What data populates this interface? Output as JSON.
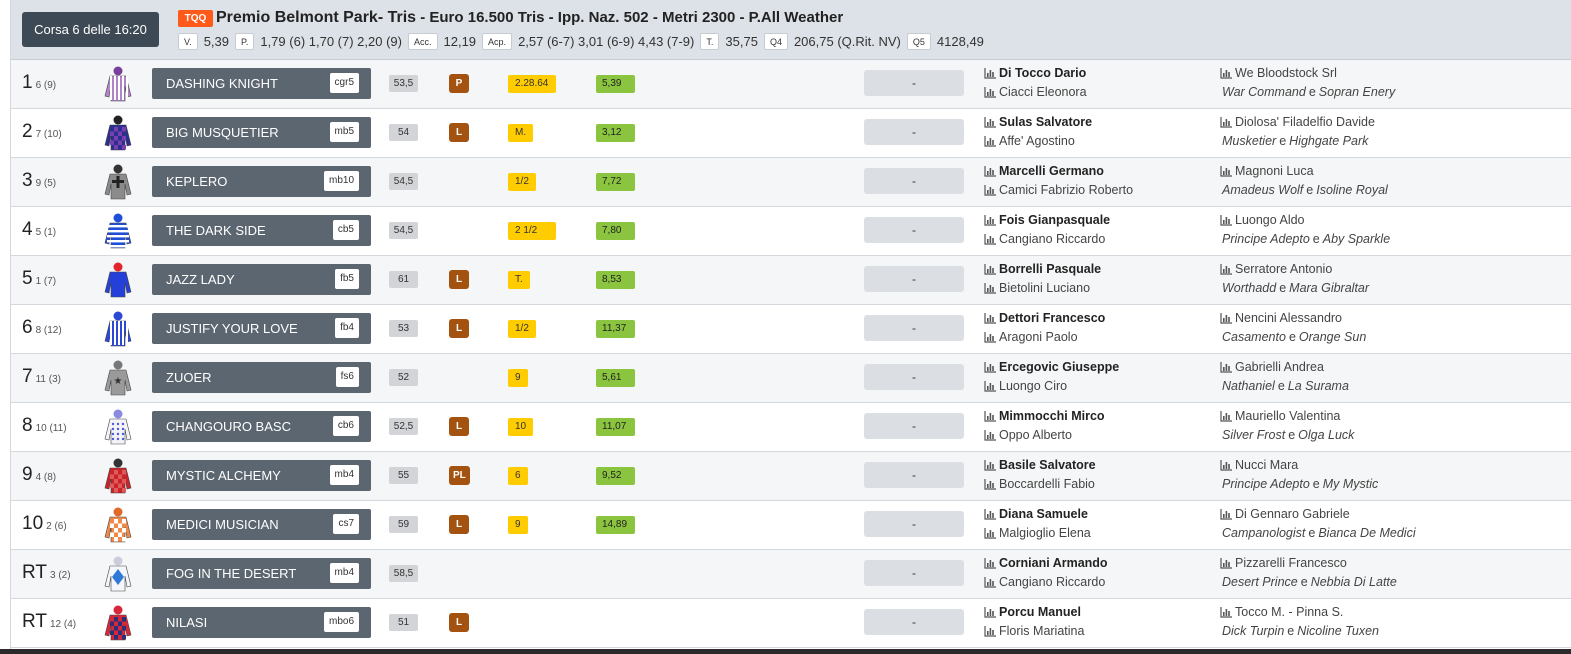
{
  "race": {
    "button_label": "Corsa 6 delle 16:20",
    "badge": "TQQ",
    "name": "Premio Belmont Park- Tris",
    "details": " - Euro 16.500 Tris - Ipp. Naz. 502 - Metri 2300 - P.All Weather",
    "quotes": [
      {
        "label": "V.",
        "value": "5,39"
      },
      {
        "label": "P.",
        "value": "1,79 (6) 1,70 (7) 2,20 (9)"
      },
      {
        "label": "Acc.",
        "value": "12,19"
      },
      {
        "label": "Acp.",
        "value": "2,57 (6-7) 3,01 (6-9) 4,43 (7-9)"
      },
      {
        "label": "T.",
        "value": "35,75"
      },
      {
        "label": "Q4",
        "value": "206,75 (Q.Rit. NV)"
      },
      {
        "label": "Q5",
        "value": "4128,49"
      }
    ]
  },
  "colors": {
    "header_bg": "#dde2e8",
    "race_button": "#3d4954",
    "tqq_badge": "#ff5a1a",
    "horse_bar": "#5c6670",
    "fascia_badge": "#a3520f",
    "prev_badge": "#ffcc00",
    "quota_badge": "#8bc53f"
  },
  "runners": [
    {
      "num": "1",
      "sub": "6 (9)",
      "silk": "purple-white-stripes",
      "horse": "DASHING KNIGHT",
      "code": "cgr5",
      "weight": "53,5",
      "fascia": "P",
      "prev": "2.28.64",
      "quota": "5,39",
      "result": "-",
      "jockey": "Di Tocco Dario",
      "trainer": "Ciacci Eleonora",
      "owner": "We Bloodstock Srl",
      "sire": "War Command",
      "dam": "Sopran Enery"
    },
    {
      "num": "2",
      "sub": "7 (10)",
      "silk": "navy-purple-check",
      "horse": "BIG MUSQUETIER",
      "code": "mb5",
      "weight": "54",
      "fascia": "L",
      "prev": "M.",
      "quota": "3,12",
      "result": "-",
      "jockey": "Sulas Salvatore",
      "trainer": "Affe' Agostino",
      "owner": "Diolosa' Filadelfio Davide",
      "sire": "Musketier",
      "dam": "Highgate Park"
    },
    {
      "num": "3",
      "sub": "9 (5)",
      "silk": "grey-black-cross",
      "horse": "KEPLERO",
      "code": "mb10",
      "weight": "54,5",
      "fascia": "",
      "prev": "1/2",
      "quota": "7,72",
      "result": "-",
      "jockey": "Marcelli Germano",
      "trainer": "Camici Fabrizio Roberto",
      "owner": "Magnoni Luca",
      "sire": "Amadeus Wolf",
      "dam": "Isoline Royal"
    },
    {
      "num": "4",
      "sub": "5 (1)",
      "silk": "blue-white-hoops",
      "horse": "THE DARK SIDE",
      "code": "cb5",
      "weight": "54,5",
      "fascia": "",
      "prev": "2 1/2",
      "quota": "7,80",
      "result": "-",
      "jockey": "Fois Gianpasquale",
      "trainer": "Cangiano Riccardo",
      "owner": "Luongo Aldo",
      "sire": "Principe Adepto",
      "dam": "Aby Sparkle"
    },
    {
      "num": "5",
      "sub": "1 (7)",
      "silk": "blue-red-cap",
      "horse": "JAZZ LADY",
      "code": "fb5",
      "weight": "61",
      "fascia": "L",
      "prev": "T.",
      "quota": "8,53",
      "result": "-",
      "jockey": "Borrelli Pasquale",
      "trainer": "Bietolini Luciano",
      "owner": "Serratore Antonio",
      "sire": "Worthadd",
      "dam": "Mara Gibraltar"
    },
    {
      "num": "6",
      "sub": "8 (12)",
      "silk": "blue-white-stripes",
      "horse": "JUSTIFY YOUR LOVE",
      "code": "fb4",
      "weight": "53",
      "fascia": "L",
      "prev": "1/2",
      "quota": "11,37",
      "result": "-",
      "jockey": "Dettori Francesco",
      "trainer": "Aragoni Paolo",
      "owner": "Nencini Alessandro",
      "sire": "Casamento",
      "dam": "Orange Sun"
    },
    {
      "num": "7",
      "sub": "11 (3)",
      "silk": "grey-black-star",
      "horse": "ZUOER",
      "code": "fs6",
      "weight": "52",
      "fascia": "",
      "prev": "9",
      "quota": "5,61",
      "result": "-",
      "jockey": "Ercegovic Giuseppe",
      "trainer": "Luongo Ciro",
      "owner": "Gabrielli Andrea",
      "sire": "Nathaniel",
      "dam": "La Surama"
    },
    {
      "num": "8",
      "sub": "10 (11)",
      "silk": "white-blue-dots",
      "horse": "CHANGOURO BASC",
      "code": "cb6",
      "weight": "52,5",
      "fascia": "L",
      "prev": "10",
      "quota": "11,07",
      "result": "-",
      "jockey": "Mimmocchi Mirco",
      "trainer": "Oppo Alberto",
      "owner": "Mauriello Valentina",
      "sire": "Silver Frost",
      "dam": "Olga Luck"
    },
    {
      "num": "9",
      "sub": "4 (8)",
      "silk": "red-check",
      "horse": "MYSTIC ALCHEMY",
      "code": "mb4",
      "weight": "55",
      "fascia": "PL",
      "prev": "6",
      "quota": "9,52",
      "result": "-",
      "jockey": "Basile Salvatore",
      "trainer": "Boccardelli Fabio",
      "owner": "Nucci Mara",
      "sire": "Principe Adepto",
      "dam": "My Mystic"
    },
    {
      "num": "10",
      "sub": "2 (6)",
      "silk": "orange-white-check",
      "horse": "MEDICI MUSICIAN",
      "code": "cs7",
      "weight": "59",
      "fascia": "L",
      "prev": "9",
      "quota": "14,89",
      "result": "-",
      "jockey": "Diana Samuele",
      "trainer": "Malgioglio Elena",
      "owner": "Di Gennaro Gabriele",
      "sire": "Campanologist",
      "dam": "Bianca De Medici"
    },
    {
      "num": "RT",
      "sub": "3 (2)",
      "silk": "white-blue-diamond",
      "horse": "FOG IN THE DESERT",
      "code": "mb4",
      "weight": "58,5",
      "fascia": "",
      "prev": "",
      "quota": "",
      "result": "-",
      "jockey": "Corniani Armando",
      "trainer": "Cangiano Riccardo",
      "owner": "Pizzarelli Francesco",
      "sire": "Desert Prince",
      "dam": "Nebbia Di Latte"
    },
    {
      "num": "RT",
      "sub": "12 (4)",
      "silk": "red-navy-check",
      "horse": "NILASI",
      "code": "mbo6",
      "weight": "51",
      "fascia": "L",
      "prev": "",
      "quota": "",
      "result": "-",
      "jockey": "Porcu Manuel",
      "trainer": "Floris Mariatina",
      "owner": "Tocco M. - Pinna S.",
      "sire": "Dick Turpin",
      "dam": "Nicoline Tuxen"
    }
  ],
  "pedigree_joiner": "e"
}
